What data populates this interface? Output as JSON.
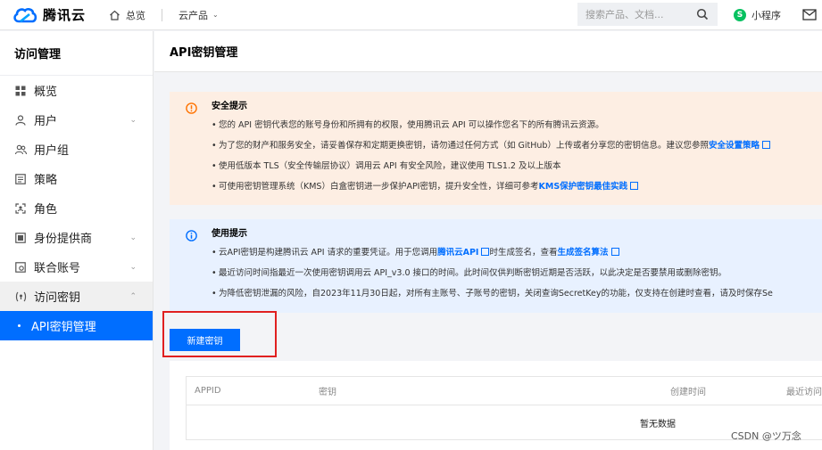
{
  "topbar": {
    "brand": "腾讯云",
    "home_label": "总览",
    "products_label": "云产品",
    "search_placeholder": "搜索产品、文档...",
    "miniapp_label": "小程序"
  },
  "sidebar": {
    "title": "访问管理",
    "items": [
      {
        "label": "概览",
        "icon": "grid-icon"
      },
      {
        "label": "用户",
        "icon": "user-icon",
        "expandable": true
      },
      {
        "label": "用户组",
        "icon": "user-group-icon"
      },
      {
        "label": "策略",
        "icon": "policy-icon"
      },
      {
        "label": "角色",
        "icon": "role-icon"
      },
      {
        "label": "身份提供商",
        "icon": "idp-icon",
        "expandable": true
      },
      {
        "label": "联合账号",
        "icon": "federated-icon",
        "expandable": true
      },
      {
        "label": "访问密钥",
        "icon": "key-icon",
        "expandable": true,
        "expanded": true
      },
      {
        "label": "API密钥管理",
        "active": true
      }
    ]
  },
  "page": {
    "title": "API密钥管理"
  },
  "security_alert": {
    "title": "安全提示",
    "items": [
      {
        "text": "您的 API 密钥代表您的账号身份和所拥有的权限，使用腾讯云 API 可以操作您名下的所有腾讯云资源。"
      },
      {
        "text": "为了您的财产和服务安全，请妥善保存和定期更换密钥，请勿通过任何方式（如 GitHub）上传或者分享您的密钥信息。建议您参照",
        "link": "安全设置策略"
      },
      {
        "text": "使用低版本 TLS（安全传输层协议）调用云 API 有安全风险，建议使用 TLS1.2 及以上版本"
      },
      {
        "text": "可使用密钥管理系统（KMS）白盒密钥进一步保护API密钥，提升安全性，详细可参考",
        "link": "KMS保护密钥最佳实践"
      }
    ]
  },
  "usage_alert": {
    "title": "使用提示",
    "items": [
      {
        "text": "云API密钥是构建腾讯云 API 请求的重要凭证。用于您调用",
        "link": "腾讯云API",
        "text2": "时生成签名，查看",
        "link2": "生成签名算法"
      },
      {
        "text": "最近访问时间指最近一次使用密钥调用云 API_v3.0 接口的时间。此时间仅供判断密钥近期是否活跃，以此决定是否要禁用或删除密钥。"
      },
      {
        "text": "为降低密钥泄漏的风险，自2023年11月30日起，对所有主账号、子账号的密钥，关闭查询SecretKey的功能，仅支持在创建时查看，请及时保存Se"
      }
    ]
  },
  "actions": {
    "create_key_label": "新建密钥"
  },
  "table": {
    "columns": [
      "APPID",
      "密钥",
      "创建时间",
      "最近访问"
    ],
    "empty_text": "暂无数据"
  },
  "watermark": "CSDN @ツ万念",
  "colors": {
    "accent": "#006eff",
    "warning_bg": "#fdeee3",
    "info_bg": "#e8f1ff",
    "highlight_border": "#e02020"
  }
}
